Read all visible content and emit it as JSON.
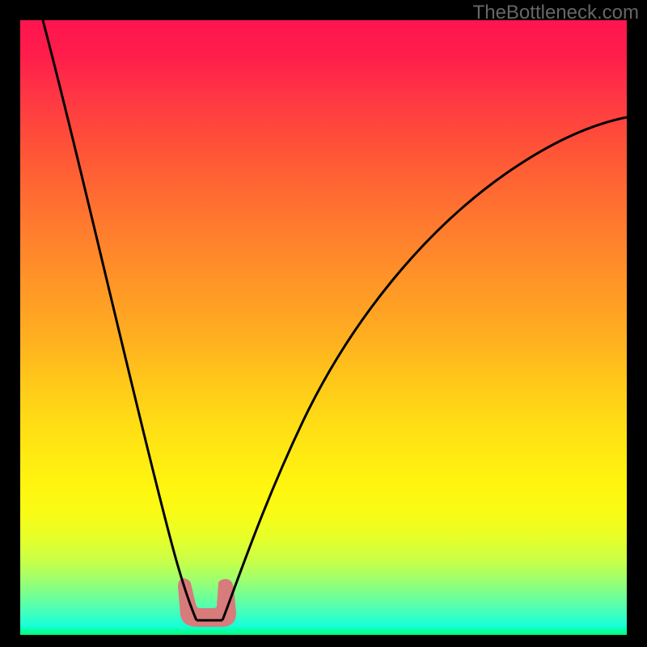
{
  "watermark": "TheBottleneck.com",
  "chart_data": {
    "type": "line",
    "title": "",
    "xlabel": "",
    "ylabel": "",
    "xlim": [
      0,
      100
    ],
    "ylim": [
      0,
      100
    ],
    "series": [
      {
        "name": "bottleneck-curve",
        "x": [
          0,
          5,
          10,
          15,
          20,
          24,
          27,
          29,
          30,
          31,
          33,
          34,
          38,
          45,
          55,
          65,
          75,
          85,
          95,
          100
        ],
        "y": [
          100,
          84,
          68,
          52,
          35,
          18,
          7,
          1,
          0,
          0,
          0,
          1,
          10,
          26,
          43,
          56,
          66,
          74,
          81,
          84
        ]
      }
    ],
    "annotations": [
      {
        "type": "highlight",
        "x_range": [
          27,
          34
        ],
        "y_range": [
          0,
          4
        ],
        "color": "#d87b7b"
      }
    ],
    "gradient": {
      "top": "#ff1450",
      "bottom": "#00ff77"
    }
  }
}
